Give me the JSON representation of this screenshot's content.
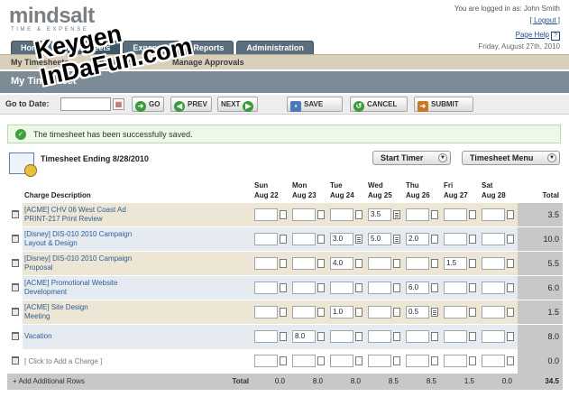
{
  "header": {
    "logo_main": "mindsalt",
    "logo_sub": "TIME & EXPENSE",
    "logged_in": "You are logged in as: John Smith",
    "logout": "[ Logout ]",
    "page_help": "Page Help",
    "help_badge": "?",
    "date": "Friday, August 27th, 2010"
  },
  "tabs": [
    "Home",
    "Timesheets",
    "Expenses",
    "Reports",
    "Administration"
  ],
  "subnav": [
    "My Timesheets",
    "Timesheets",
    "Manage Approvals"
  ],
  "page_title": "My Timesheet",
  "toolbar": {
    "goto_label": "Go to Date:",
    "date_value": "",
    "go": "GO",
    "prev": "PREV",
    "next": "NEXT",
    "save": "SAVE",
    "cancel": "CANCEL",
    "submit": "SUBMIT"
  },
  "message": "The timesheet has been successfully saved.",
  "timesheet": {
    "title": "Timesheet Ending 8/28/2010",
    "start_timer": "Start Timer",
    "menu": "Timesheet Menu"
  },
  "table": {
    "desc_header": "Charge Description",
    "days": [
      {
        "dow": "Sun",
        "date": "Aug 22"
      },
      {
        "dow": "Mon",
        "date": "Aug 23"
      },
      {
        "dow": "Tue",
        "date": "Aug 24"
      },
      {
        "dow": "Wed",
        "date": "Aug 25"
      },
      {
        "dow": "Thu",
        "date": "Aug 26"
      },
      {
        "dow": "Fri",
        "date": "Aug 27"
      },
      {
        "dow": "Sat",
        "date": "Aug 28"
      }
    ],
    "total_header": "Total",
    "rows": [
      {
        "line1": "[ACME] CHV 06 West Coast Ad",
        "line2": "PRINT-217 Print Review",
        "hours": [
          "",
          "",
          "",
          "3.5",
          "",
          "",
          ""
        ],
        "notes": [
          false,
          false,
          false,
          true,
          false,
          false,
          false
        ],
        "total": "3.5",
        "shade": true
      },
      {
        "line1": "[Disney] DIS-010 2010 Campaign",
        "line2": "Layout & Design",
        "hours": [
          "",
          "",
          "3.0",
          "5.0",
          "2.0",
          "",
          ""
        ],
        "notes": [
          false,
          false,
          true,
          true,
          false,
          false,
          false
        ],
        "total": "10.0",
        "shade": false
      },
      {
        "line1": "[Disney] DIS-010 2010 Campaign",
        "line2": "Proposal",
        "hours": [
          "",
          "",
          "4.0",
          "",
          "",
          "1.5",
          ""
        ],
        "notes": [
          false,
          false,
          false,
          false,
          false,
          false,
          false
        ],
        "total": "5.5",
        "shade": true
      },
      {
        "line1": "[ACME] Promotional Website",
        "line2": "Development",
        "hours": [
          "",
          "",
          "",
          "",
          "6.0",
          "",
          ""
        ],
        "notes": [
          false,
          false,
          false,
          false,
          false,
          false,
          false
        ],
        "total": "6.0",
        "shade": false
      },
      {
        "line1": "[ACME] Site Design",
        "line2": "Meeting",
        "hours": [
          "",
          "",
          "1.0",
          "",
          "0.5",
          "",
          ""
        ],
        "notes": [
          false,
          false,
          false,
          false,
          true,
          false,
          false
        ],
        "total": "1.5",
        "shade": true
      },
      {
        "line1": "Vacation",
        "line2": "",
        "hours": [
          "",
          "8.0",
          "",
          "",
          "",
          "",
          ""
        ],
        "notes": [
          false,
          false,
          false,
          false,
          false,
          false,
          false
        ],
        "total": "8.0",
        "shade": false
      }
    ],
    "add_charge": "[ Click to Add a Charge ]",
    "add_total": "0.0",
    "add_rows": "+ Add Additional Rows",
    "total_label": "Total",
    "day_totals": [
      "0.0",
      "8.0",
      "8.0",
      "8.5",
      "8.5",
      "1.5",
      "0.0"
    ],
    "grand_total": "34.5"
  },
  "watermark": "Keygen\nInDaFun.com"
}
